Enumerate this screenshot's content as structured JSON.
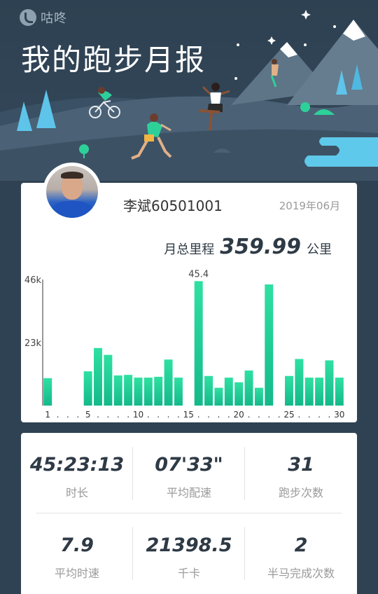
{
  "header": {
    "brand": "咕咚",
    "title": "我的跑步月报"
  },
  "profile": {
    "username": "李斌60501001",
    "month": "2019年06月"
  },
  "summary": {
    "distance_label": "月总里程",
    "distance_value": "359.99",
    "distance_unit": "公里"
  },
  "chart_data": {
    "type": "bar",
    "x": [
      1,
      2,
      3,
      4,
      5,
      6,
      7,
      8,
      9,
      10,
      11,
      12,
      13,
      14,
      15,
      16,
      17,
      18,
      19,
      20,
      21,
      22,
      23,
      24,
      25,
      26,
      27,
      28,
      29,
      30
    ],
    "values": [
      10,
      0,
      0,
      0,
      12.5,
      21,
      18.5,
      11,
      11.2,
      10.2,
      10.2,
      10.5,
      16.8,
      10.2,
      0,
      45.4,
      10.8,
      6.5,
      10.2,
      8.5,
      12.8,
      6.5,
      44.2,
      0,
      10.8,
      17,
      10.2,
      10.2,
      16.5,
      10.2
    ],
    "ylim": [
      0,
      46
    ],
    "yticks": [
      "23k",
      "46k"
    ],
    "xticks": [
      "1",
      ".",
      ".",
      ".",
      "5",
      ".",
      ".",
      ".",
      ".",
      "10",
      ".",
      ".",
      ".",
      ".",
      "15",
      ".",
      ".",
      ".",
      ".",
      "20",
      ".",
      ".",
      ".",
      ".",
      "25",
      ".",
      ".",
      ".",
      ".",
      "30"
    ],
    "data_labels": [
      {
        "day": 16,
        "text": "45.4"
      }
    ],
    "colors": {
      "top": "#2fe0a2",
      "bottom": "#14b98a"
    }
  },
  "stats": [
    {
      "value": "45:23:13",
      "label": "时长"
    },
    {
      "value": "07'33\"",
      "label": "平均配速"
    },
    {
      "value": "31",
      "label": "跑步次数"
    },
    {
      "value": "7.9",
      "label": "平均时速"
    },
    {
      "value": "21398.5",
      "label": "千卡"
    },
    {
      "value": "2",
      "label": "半马完成次数"
    }
  ],
  "colors": {
    "background": "#2f4253",
    "accent": "#20c895",
    "card": "#ffffff"
  }
}
